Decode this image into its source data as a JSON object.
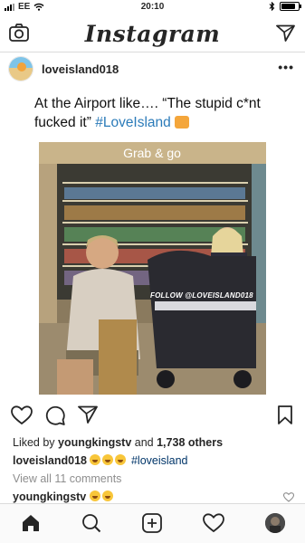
{
  "status": {
    "carrier": "EE",
    "time": "20:10"
  },
  "nav": {
    "title": "Instagram"
  },
  "post": {
    "username": "loveisland018",
    "overlay_line1": "At the Airport like…. “The stupid c*nt",
    "overlay_line2": "fucked it” ",
    "overlay_hashtag": "#LoveIsland",
    "store_sign": "Grab & go",
    "watermark": "FOLLOW @LOVEISLAND018",
    "liked_by_prefix": "Liked by ",
    "liked_by_user": "youngkingstv",
    "liked_by_and": " and ",
    "liked_by_count": "1,738 others",
    "caption_user": "loveisland018",
    "caption_hashtag": "#loveisland",
    "view_all": "View all 11 comments",
    "comment_user": "youngkingstv"
  },
  "icons": {
    "nav_left": "camera-icon",
    "nav_right": "direct-message-icon",
    "like": "heart-icon",
    "comment": "comment-icon",
    "share": "share-icon",
    "save": "bookmark-icon",
    "tabs": [
      "home-icon",
      "search-icon",
      "new-post-icon",
      "activity-icon",
      "profile-avatar"
    ]
  },
  "colors": {
    "text": "#262626",
    "hashtag": "#003569",
    "muted": "#8e8e8e",
    "border": "#dbdbdb"
  }
}
